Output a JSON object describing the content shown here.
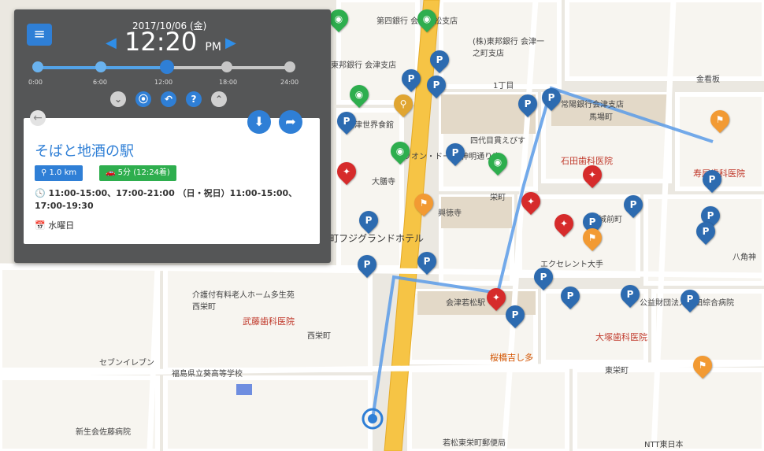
{
  "panel": {
    "date": "2017/10/06 (金)",
    "time": "12:20",
    "ampm": "PM",
    "timeline_labels": [
      "0:00",
      "6:00",
      "12:00",
      "18:00",
      "24:00"
    ],
    "controls": [
      "chevron-down",
      "location",
      "undo",
      "help",
      "chevron-up"
    ],
    "place": {
      "name": "そばと地酒の駅",
      "distance": "1.0 km",
      "duration": "5分",
      "duration_detail": "(12:24着)",
      "hours_label": "11:00-15:00、17:00-21:00 （日・祝日）11:00-15:00、17:00-19:30",
      "closed_day": "水曜日"
    }
  },
  "map_labels": [
    {
      "text": "第四銀行 会津若松支店",
      "cls": "big"
    },
    {
      "text": "(株)東邦銀行 会津一之町支店",
      "cls": "big"
    },
    {
      "text": "東邦銀行 会津支店",
      "cls": "big"
    },
    {
      "text": "常陽銀行会津支店",
      "cls": "big"
    },
    {
      "text": "馬場町",
      "cls": "big"
    },
    {
      "text": "1丁目",
      "cls": ""
    },
    {
      "text": "会津世界食館",
      "cls": ""
    },
    {
      "text": "四代目貫えびす",
      "cls": ""
    },
    {
      "text": "リオン・ドール 神明通り店",
      "cls": "big"
    },
    {
      "text": "石田歯科医院",
      "cls": "red"
    },
    {
      "text": "大膳寺",
      "cls": ""
    },
    {
      "text": "栄町",
      "cls": "big"
    },
    {
      "text": "興徳寺",
      "cls": "big"
    },
    {
      "text": "町フジグランドホテル",
      "cls": "big"
    },
    {
      "text": "エクセレント大手",
      "cls": ""
    },
    {
      "text": "城前町",
      "cls": "big"
    },
    {
      "text": "八角神",
      "cls": "big"
    },
    {
      "text": "寿屋歯科医院",
      "cls": "red"
    },
    {
      "text": "大塚歯科医院",
      "cls": "red"
    },
    {
      "text": "会津若松駅",
      "cls": "big"
    },
    {
      "text": "介護付有料老人ホーム多生苑 西栄町",
      "cls": "big"
    },
    {
      "text": "武藤歯科医院",
      "cls": "red"
    },
    {
      "text": "西栄町",
      "cls": "big"
    },
    {
      "text": "福島県立葵高等学校",
      "cls": "big"
    },
    {
      "text": "桜橋吉し多",
      "cls": "orange"
    },
    {
      "text": "東栄町",
      "cls": "big"
    },
    {
      "text": "新生会佐藤病院",
      "cls": "big"
    },
    {
      "text": "若松東栄町郵便局",
      "cls": "big"
    },
    {
      "text": "公益財団法人竹田綜合病院",
      "cls": "big"
    },
    {
      "text": "セブンイレブン",
      "cls": ""
    },
    {
      "text": "NTT東日本",
      "cls": ""
    },
    {
      "text": "金看板",
      "cls": "big"
    }
  ],
  "colors": {
    "route": "#5b9be8",
    "road_main": "#f6c445",
    "panel_bg": "#555657",
    "accent": "#2f7fd6",
    "badge_green": "#2eae4e"
  }
}
